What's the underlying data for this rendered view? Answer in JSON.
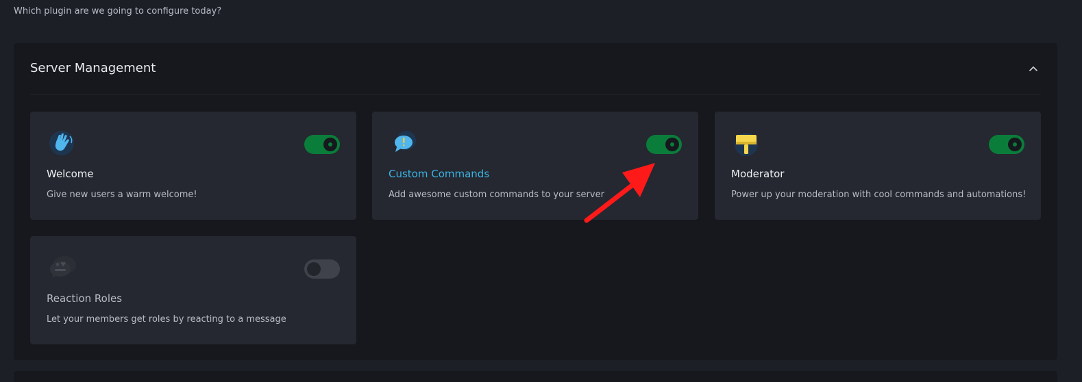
{
  "subtitle": "Which plugin are we going to configure today?",
  "section": {
    "title": "Server Management",
    "collapse_icon": "chevron-up-icon"
  },
  "plugins": [
    {
      "name": "Welcome",
      "description": "Give new users a warm welcome!",
      "icon": "wave-hand-icon",
      "enabled": true
    },
    {
      "name": "Custom Commands",
      "description": "Add awesome custom commands to your server",
      "icon": "chat-bubble-exclamation-icon",
      "enabled": true
    },
    {
      "name": "Moderator",
      "description": "Power up your moderation with cool commands and automations!",
      "icon": "ban-hammer-icon",
      "enabled": true
    },
    {
      "name": "Reaction Roles",
      "description": "Let your members get roles by reacting to a message",
      "icon": "reaction-chat-icon",
      "enabled": false
    }
  ],
  "colors": {
    "background": "#1c1f26",
    "section": "#16181d",
    "card": "#252830",
    "toggle_on": "#0b7d3a",
    "toggle_off": "#3f424a",
    "link": "#3ab4e6",
    "annotation_arrow": "#ff1a1a"
  }
}
